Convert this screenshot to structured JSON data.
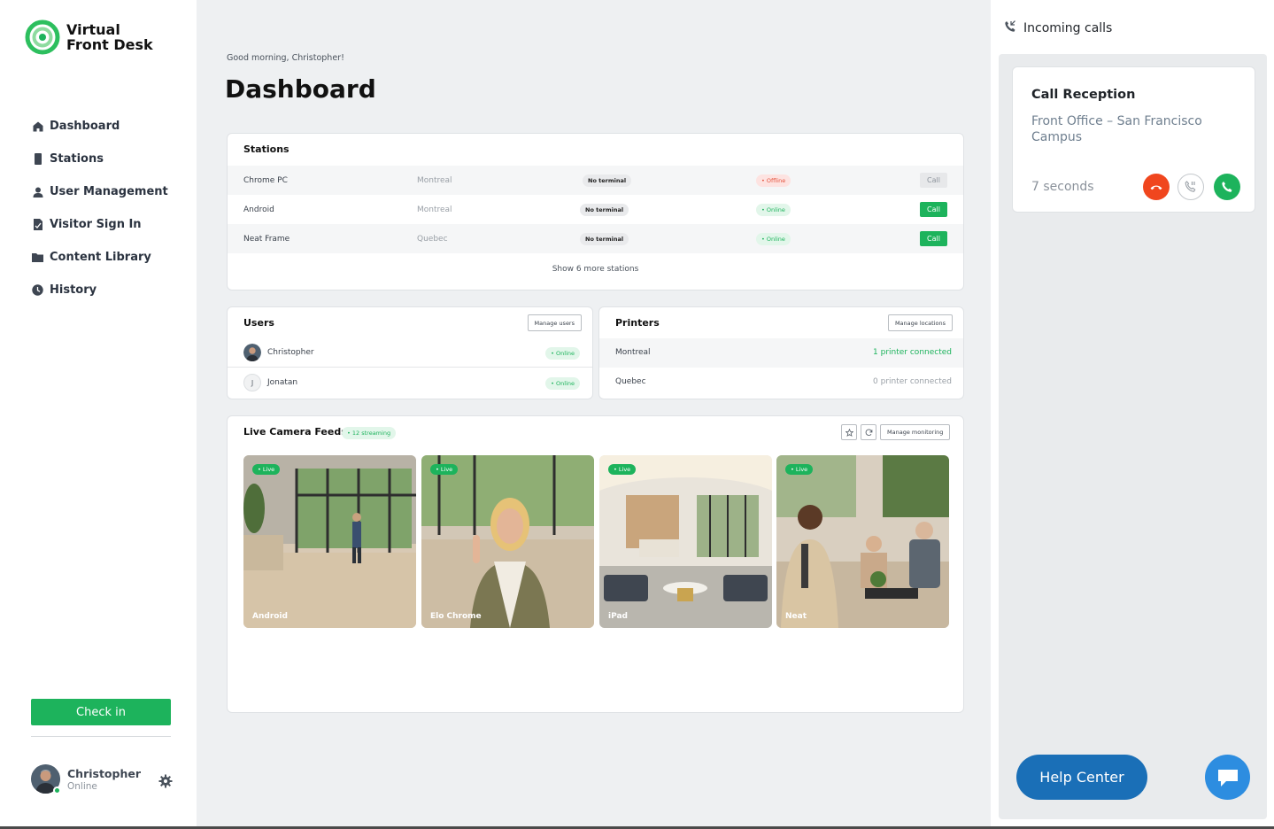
{
  "app": {
    "logo_line1": "Virtual",
    "logo_line2": "Front Desk",
    "brand_color": "#1db35c"
  },
  "sidebar": {
    "items": [
      {
        "label": "Dashboard",
        "icon": "home-icon"
      },
      {
        "label": "Stations",
        "icon": "tablet-icon"
      },
      {
        "label": "User Management",
        "icon": "user-icon"
      },
      {
        "label": "Visitor Sign In",
        "icon": "document-sign-icon"
      },
      {
        "label": "Content Library",
        "icon": "folder-icon"
      },
      {
        "label": "History",
        "icon": "clock-icon"
      }
    ],
    "checkin_label": "Check in",
    "profile": {
      "name": "Christopher",
      "status": "Online"
    }
  },
  "main": {
    "greeting": "Good morning, Christopher!",
    "title": "Dashboard"
  },
  "stations": {
    "title": "Stations",
    "rows": [
      {
        "name": "Chrome PC",
        "location": "Montreal",
        "terminal": "No terminal",
        "status": "• Offline",
        "action": "Call"
      },
      {
        "name": "Android",
        "location": "Montreal",
        "terminal": "No terminal",
        "status": "• Online",
        "action": "Call"
      },
      {
        "name": "Neat Frame",
        "location": "Quebec",
        "terminal": "No terminal",
        "status": "• Online",
        "action": "Call"
      }
    ],
    "show_more": "Show 6 more stations"
  },
  "users": {
    "title": "Users",
    "manage_label": "Manage users",
    "rows": [
      {
        "name": "Christopher",
        "status": "• Online",
        "initial": ""
      },
      {
        "name": "Jonatan",
        "status": "• Online",
        "initial": "J"
      }
    ]
  },
  "printers": {
    "title": "Printers",
    "manage_label": "Manage locations",
    "rows": [
      {
        "location": "Montreal",
        "status": "1 printer connected"
      },
      {
        "location": "Quebec",
        "status": "0 printer connected"
      }
    ]
  },
  "cameras": {
    "title": "Live Camera Feeds",
    "streaming_badge": "• 12 streaming",
    "manage_label": "Manage monitoring",
    "live_label": "• Live",
    "feeds": [
      {
        "label": "Android"
      },
      {
        "label": "Elo Chrome"
      },
      {
        "label": "iPad"
      },
      {
        "label": "Neat"
      }
    ]
  },
  "incoming": {
    "header": "Incoming calls",
    "call": {
      "title": "Call Reception",
      "location": "Front Office – San Francisco Campus",
      "elapsed": "7 seconds"
    },
    "colors": {
      "decline": "#f0461e",
      "accept": "#1db35c"
    }
  },
  "help": {
    "label": "Help Center"
  }
}
